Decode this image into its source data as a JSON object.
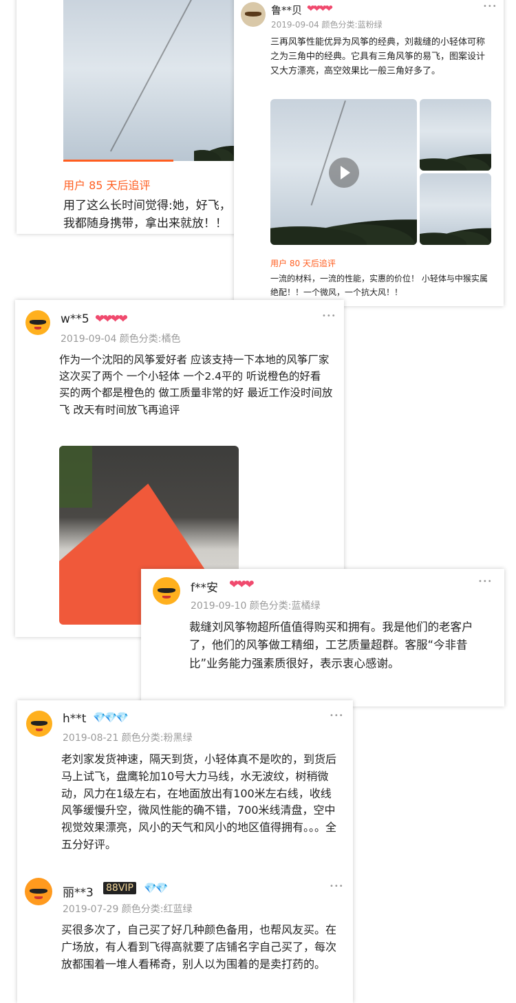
{
  "colors": {
    "accent": "#ff5d1f",
    "heart": "#f04a6e",
    "diamond": "#ffb400",
    "meta": "#9a9a9a"
  },
  "card1": {
    "followup_label": "用户 85 天后追评",
    "followup_text_line1": "用了这么长时间觉得:她，好飞，",
    "followup_text_line2": "我都随身携带，拿出来就放！！"
  },
  "card2": {
    "user": "鲁**贝",
    "hearts": "❤❤❤❤",
    "date_color": "2019-09-04 颜色分类:蓝粉绿",
    "more": "•••",
    "text": "三再风筝性能优异为风筝的经典，刘裁缝的小轻体可称之为三角中的经典。它具有三角风筝的易飞，图案设计又大方漂亮，高空效果比一般三角好多了。",
    "followup_label": "用户 80 天后追评",
    "followup_text": "一流的材料，一流的性能，实惠的价位！ 小轻体与中猴实属绝配！！一个微风，一个抗大风！！"
  },
  "card3": {
    "user": "w**5",
    "hearts": "❤❤❤❤",
    "date_color": "2019-09-04 颜色分类:橘色",
    "more": "•••",
    "text": "作为一个沈阳的风筝爱好者  应该支持一下本地的风筝厂家 这次买了两个  一个小轻体  一个2.4平的 听说橙色的好看 买的两个都是橙色的  做工质量非常的好  最近工作没时间放飞  改天有时间放飞再追评"
  },
  "card4": {
    "user": "f**安",
    "hearts": "❤❤❤",
    "date_color": "2019-09-10 颜色分类:蓝橘绿",
    "more": "•••",
    "text": "裁缝刘风筝物超所值值得购买和拥有。我是他们的老客户了，他们的风筝做工精细，工艺质量超群。客服“今非昔比”业务能力强素质很好，表示衷心感谢。"
  },
  "card5": {
    "review1": {
      "user": "h**t",
      "diamonds": "💎💎💎",
      "date_color": "2019-08-21 颜色分类:粉黑绿",
      "more": "•••",
      "text": "老刘家发货神速，隔天到货，小轻体真不是吹的，到货后马上试飞，盘鹰轮加10号大力马线，水无波纹，树稍微动，风力在1级左右，在地面放出有100米左右线，收线 风筝缓慢升空，微风性能的确不错，700米线清盘，空中视觉效果漂亮，风小的天气和风小的地区值得拥有。。。全五分好评。"
    },
    "review2": {
      "user": "丽**3",
      "vip": "88VIP",
      "diamonds": "💎💎",
      "date_color": "2019-07-29 颜色分类:红蓝绿",
      "more": "•••",
      "text": "买很多次了，自己买了好几种颜色备用，也帮风友买。在广场放，有人看到飞得高就要了店铺名字自己买了，每次放都围着一堆人看稀奇，别人以为围着的是卖打药的。"
    }
  }
}
